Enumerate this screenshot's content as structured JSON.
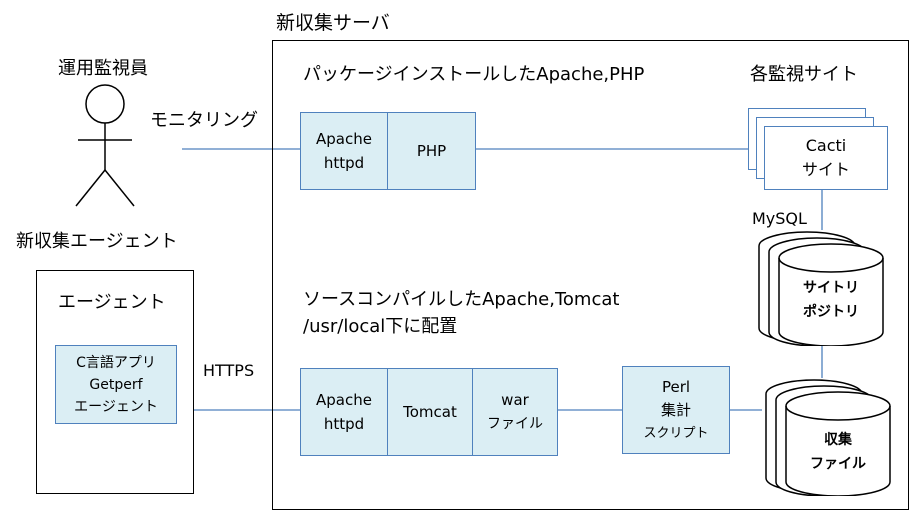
{
  "server": {
    "title": "新収集サーバ",
    "pkg_caption": "パッケージインストールしたApache,PHP",
    "src_caption_line1": "ソースコンパイルしたApache,Tomcat",
    "src_caption_line2": "/usr/local下に配置",
    "sites_title": "各監視サイト"
  },
  "operator": {
    "label": "運用監視員",
    "action": "モニタリング"
  },
  "agent": {
    "outer_label": "新収集エージェント",
    "box_title": "エージェント",
    "component_line1": "C言語アプリ",
    "component_line2": "Getperf",
    "component_line3": "エージェント",
    "protocol": "HTTPS"
  },
  "top_row": {
    "apache_line1": "Apache",
    "apache_line2": "httpd",
    "php": "PHP"
  },
  "bottom_row": {
    "apache_line1": "Apache",
    "apache_line2": "httpd",
    "tomcat": "Tomcat",
    "war_line1": "war",
    "war_line2": "ファイル"
  },
  "perl": {
    "line1": "Perl",
    "line2": "集計",
    "line3": "スクリプト"
  },
  "cacti": {
    "line1": "Cacti",
    "line2": "サイト"
  },
  "mysql_label": "MySQL",
  "repo": {
    "line1": "サイトリ",
    "line2": "ポジトリ"
  },
  "files": {
    "line1": "収集",
    "line2": "ファイル"
  },
  "colors": {
    "box_fill": "#dbeef4",
    "box_border": "#4f81bd",
    "line": "#4f81bd"
  }
}
